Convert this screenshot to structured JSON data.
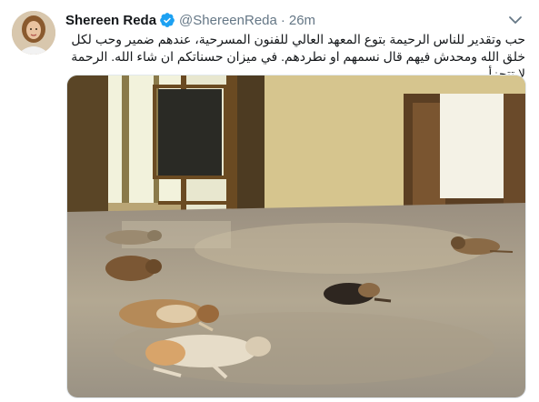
{
  "tweet": {
    "display_name": "Shereen Reda",
    "handle": "@ShereenReda",
    "separator": "·",
    "time": "26m",
    "text": "حب وتقدير للناس الرحيمة بتوع المعهد العالي للفنون المسرحية، عندهم ضمير وحب لكل خلق الله ومحدش فيهم قال نسمهم او نطردهم. في ميزان حسناتكم ان شاء الله. الرحمة لا تتجزأ"
  },
  "icons": {
    "verified": "verified-badge-icon",
    "caret": "chevron-down-icon"
  },
  "colors": {
    "verified_blue": "#1da1f2",
    "muted_gray": "#657786",
    "text_dark": "#14171a"
  }
}
